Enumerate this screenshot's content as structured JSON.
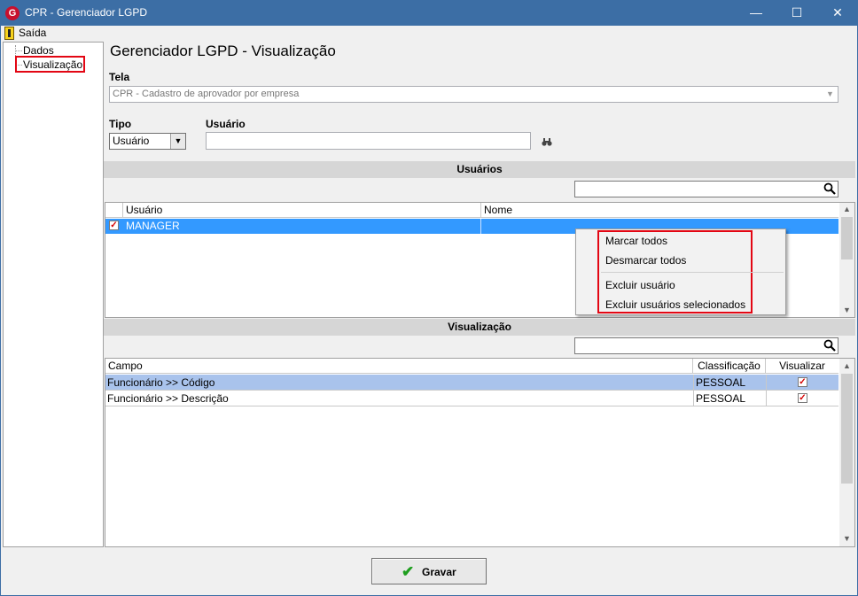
{
  "window": {
    "title": "CPR - Gerenciador LGPD",
    "app_icon_letter": "G",
    "minimize_glyph": "—",
    "maximize_glyph": "☐",
    "close_glyph": "✕"
  },
  "menu": {
    "exit_label": "Saída"
  },
  "tree": {
    "items": [
      {
        "label": "Dados"
      },
      {
        "label": "Visualização"
      }
    ]
  },
  "main": {
    "page_title": "Gerenciador LGPD - Visualização",
    "tela_label": "Tela",
    "tela_value": "CPR - Cadastro de aprovador por empresa",
    "tipo_label": "Tipo",
    "tipo_value": "Usuário",
    "usuario_label": "Usuário",
    "usuario_value": ""
  },
  "usuarios_section": {
    "header": "Usuários",
    "columns": [
      "Usuário",
      "Nome"
    ],
    "rows": [
      {
        "checked": true,
        "usuario": "MANAGER",
        "nome": ""
      }
    ]
  },
  "context_menu": {
    "items": [
      "Marcar todos",
      "Desmarcar todos",
      "Excluir usuário",
      "Excluir usuários selecionados"
    ]
  },
  "visualizacao_section": {
    "header": "Visualização",
    "columns": [
      "Campo",
      "Classificação",
      "Visualizar"
    ],
    "rows": [
      {
        "campo": "Funcionário >> Código",
        "classificacao": "PESSOAL",
        "visualizar": true
      },
      {
        "campo": "Funcionário >> Descrição",
        "classificacao": "PESSOAL",
        "visualizar": true
      }
    ]
  },
  "footer": {
    "gravar_label": "Gravar"
  },
  "icons": {
    "app": "app-logo-icon",
    "exit": "exit-door-icon",
    "search": "magnifier-icon",
    "binoculars": "binoculars-icon",
    "confirm": "green-check-icon"
  },
  "colors": {
    "titlebar": "#3c6ea5",
    "selection": "#3399ff",
    "highlight_box": "#e30613"
  }
}
